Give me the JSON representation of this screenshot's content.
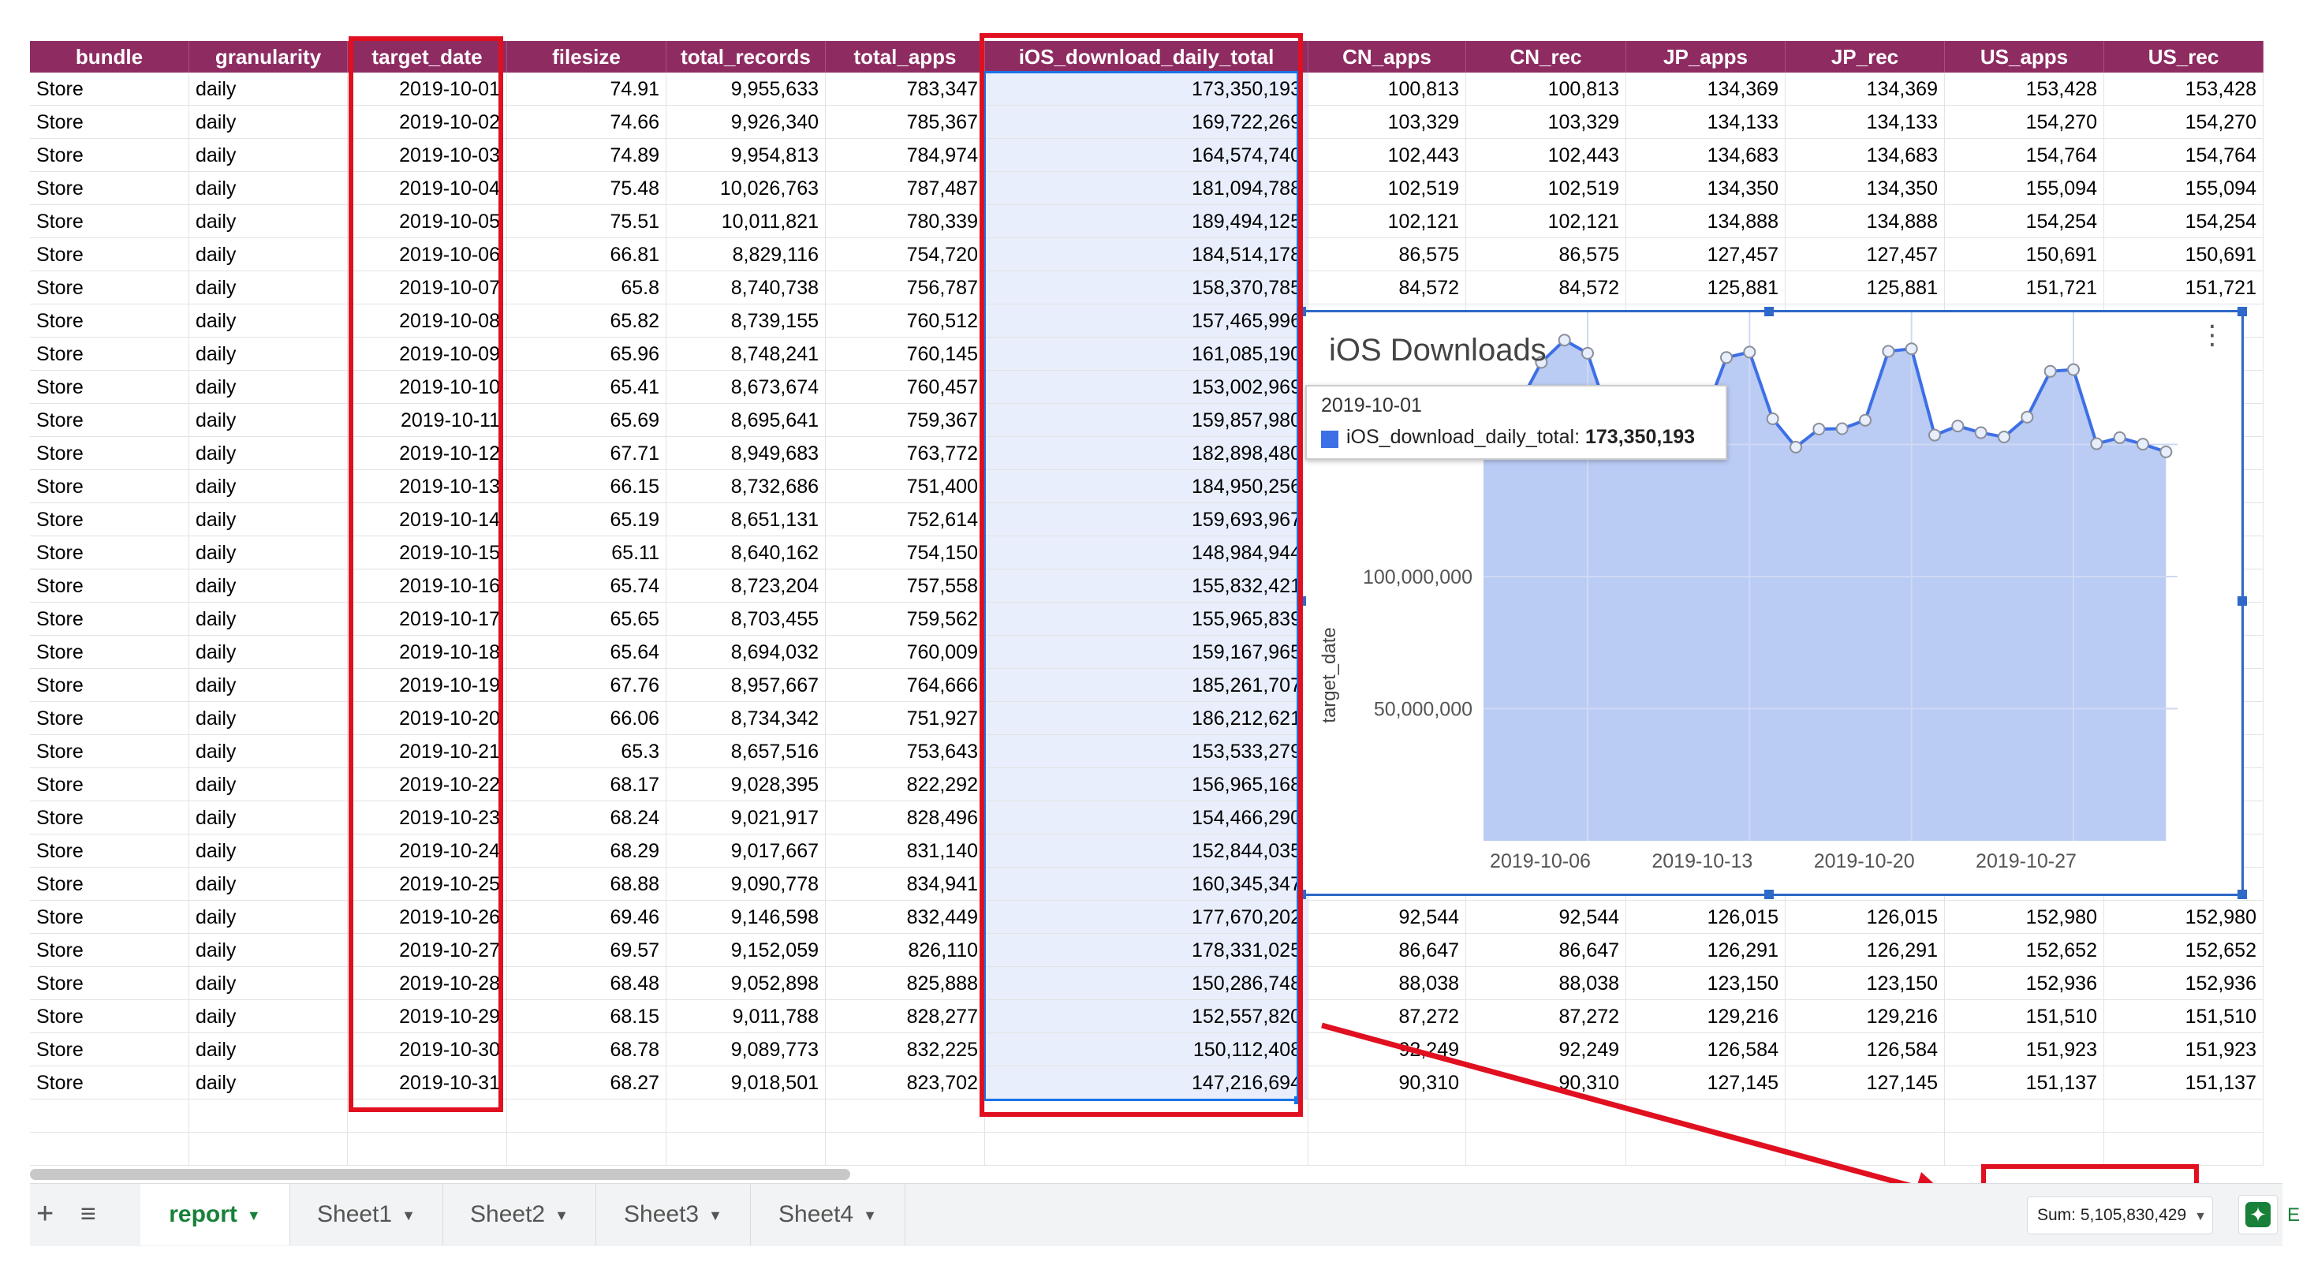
{
  "columns": [
    {
      "name": "bundle",
      "align": "left"
    },
    {
      "name": "granularity",
      "align": "left"
    },
    {
      "name": "target_date",
      "align": "right"
    },
    {
      "name": "filesize",
      "align": "right"
    },
    {
      "name": "total_records",
      "align": "right"
    },
    {
      "name": "total_apps",
      "align": "right"
    },
    {
      "name": "iOS_download_daily_total",
      "align": "right"
    },
    {
      "name": "CN_apps",
      "align": "right"
    },
    {
      "name": "CN_rec",
      "align": "right"
    },
    {
      "name": "JP_apps",
      "align": "right"
    },
    {
      "name": "JP_rec",
      "align": "right"
    },
    {
      "name": "US_apps",
      "align": "right"
    },
    {
      "name": "US_rec",
      "align": "right"
    }
  ],
  "rows": [
    [
      "Store",
      "daily",
      "2019-10-01",
      "74.91",
      "9,955,633",
      "783,347",
      "173,350,193",
      "100,813",
      "100,813",
      "134,369",
      "134,369",
      "153,428",
      "153,428"
    ],
    [
      "Store",
      "daily",
      "2019-10-02",
      "74.66",
      "9,926,340",
      "785,367",
      "169,722,269",
      "103,329",
      "103,329",
      "134,133",
      "134,133",
      "154,270",
      "154,270"
    ],
    [
      "Store",
      "daily",
      "2019-10-03",
      "74.89",
      "9,954,813",
      "784,974",
      "164,574,740",
      "102,443",
      "102,443",
      "134,683",
      "134,683",
      "154,764",
      "154,764"
    ],
    [
      "Store",
      "daily",
      "2019-10-04",
      "75.48",
      "10,026,763",
      "787,487",
      "181,094,788",
      "102,519",
      "102,519",
      "134,350",
      "134,350",
      "155,094",
      "155,094"
    ],
    [
      "Store",
      "daily",
      "2019-10-05",
      "75.51",
      "10,011,821",
      "780,339",
      "189,494,125",
      "102,121",
      "102,121",
      "134,888",
      "134,888",
      "154,254",
      "154,254"
    ],
    [
      "Store",
      "daily",
      "2019-10-06",
      "66.81",
      "8,829,116",
      "754,720",
      "184,514,178",
      "86,575",
      "86,575",
      "127,457",
      "127,457",
      "150,691",
      "150,691"
    ],
    [
      "Store",
      "daily",
      "2019-10-07",
      "65.8",
      "8,740,738",
      "756,787",
      "158,370,785",
      "84,572",
      "84,572",
      "125,881",
      "125,881",
      "151,721",
      "151,721"
    ],
    [
      "Store",
      "daily",
      "2019-10-08",
      "65.82",
      "8,739,155",
      "760,512",
      "157,465,996",
      "",
      "",
      "",
      "",
      "",
      ""
    ],
    [
      "Store",
      "daily",
      "2019-10-09",
      "65.96",
      "8,748,241",
      "760,145",
      "161,085,190",
      "",
      "",
      "",
      "",
      "",
      ""
    ],
    [
      "Store",
      "daily",
      "2019-10-10",
      "65.41",
      "8,673,674",
      "760,457",
      "153,002,969",
      "",
      "",
      "",
      "",
      "",
      ""
    ],
    [
      "Store",
      "daily",
      "2019-10-11",
      "65.69",
      "8,695,641",
      "759,367",
      "159,857,980",
      "",
      "",
      "",
      "",
      "",
      ""
    ],
    [
      "Store",
      "daily",
      "2019-10-12",
      "67.71",
      "8,949,683",
      "763,772",
      "182,898,480",
      "",
      "",
      "",
      "",
      "",
      ""
    ],
    [
      "Store",
      "daily",
      "2019-10-13",
      "66.15",
      "8,732,686",
      "751,400",
      "184,950,256",
      "",
      "",
      "",
      "",
      "",
      ""
    ],
    [
      "Store",
      "daily",
      "2019-10-14",
      "65.19",
      "8,651,131",
      "752,614",
      "159,693,967",
      "",
      "",
      "",
      "",
      "",
      ""
    ],
    [
      "Store",
      "daily",
      "2019-10-15",
      "65.11",
      "8,640,162",
      "754,150",
      "148,984,944",
      "",
      "",
      "",
      "",
      "",
      ""
    ],
    [
      "Store",
      "daily",
      "2019-10-16",
      "65.74",
      "8,723,204",
      "757,558",
      "155,832,421",
      "",
      "",
      "",
      "",
      "",
      ""
    ],
    [
      "Store",
      "daily",
      "2019-10-17",
      "65.65",
      "8,703,455",
      "759,562",
      "155,965,839",
      "",
      "",
      "",
      "",
      "",
      ""
    ],
    [
      "Store",
      "daily",
      "2019-10-18",
      "65.64",
      "8,694,032",
      "760,009",
      "159,167,965",
      "",
      "",
      "",
      "",
      "",
      ""
    ],
    [
      "Store",
      "daily",
      "2019-10-19",
      "67.76",
      "8,957,667",
      "764,666",
      "185,261,707",
      "",
      "",
      "",
      "",
      "",
      ""
    ],
    [
      "Store",
      "daily",
      "2019-10-20",
      "66.06",
      "8,734,342",
      "751,927",
      "186,212,621",
      "",
      "",
      "",
      "",
      "",
      ""
    ],
    [
      "Store",
      "daily",
      "2019-10-21",
      "65.3",
      "8,657,516",
      "753,643",
      "153,533,279",
      "",
      "",
      "",
      "",
      "",
      ""
    ],
    [
      "Store",
      "daily",
      "2019-10-22",
      "68.17",
      "9,028,395",
      "822,292",
      "156,965,168",
      "",
      "",
      "",
      "",
      "",
      ""
    ],
    [
      "Store",
      "daily",
      "2019-10-23",
      "68.24",
      "9,021,917",
      "828,496",
      "154,466,290",
      "",
      "",
      "",
      "",
      "",
      ""
    ],
    [
      "Store",
      "daily",
      "2019-10-24",
      "68.29",
      "9,017,667",
      "831,140",
      "152,844,035",
      "",
      "",
      "",
      "",
      "",
      ""
    ],
    [
      "Store",
      "daily",
      "2019-10-25",
      "68.88",
      "9,090,778",
      "834,941",
      "160,345,347",
      "",
      "",
      "",
      "",
      "",
      ""
    ],
    [
      "Store",
      "daily",
      "2019-10-26",
      "69.46",
      "9,146,598",
      "832,449",
      "177,670,202",
      "92,544",
      "92,544",
      "126,015",
      "126,015",
      "152,980",
      "152,980"
    ],
    [
      "Store",
      "daily",
      "2019-10-27",
      "69.57",
      "9,152,059",
      "826,110",
      "178,331,025",
      "86,647",
      "86,647",
      "126,291",
      "126,291",
      "152,652",
      "152,652"
    ],
    [
      "Store",
      "daily",
      "2019-10-28",
      "68.48",
      "9,052,898",
      "825,888",
      "150,286,748",
      "88,038",
      "88,038",
      "123,150",
      "123,150",
      "152,936",
      "152,936"
    ],
    [
      "Store",
      "daily",
      "2019-10-29",
      "68.15",
      "9,011,788",
      "828,277",
      "152,557,820",
      "87,272",
      "87,272",
      "129,216",
      "129,216",
      "151,510",
      "151,510"
    ],
    [
      "Store",
      "daily",
      "2019-10-30",
      "68.78",
      "9,089,773",
      "832,225",
      "150,112,408",
      "92,249",
      "92,249",
      "126,584",
      "126,584",
      "151,923",
      "151,923"
    ],
    [
      "Store",
      "daily",
      "2019-10-31",
      "68.27",
      "9,018,501",
      "823,702",
      "147,216,694",
      "90,310",
      "90,310",
      "127,145",
      "127,145",
      "151,137",
      "151,137"
    ]
  ],
  "chart_data": {
    "type": "area",
    "title": "iOS Downloads",
    "xlabel": "",
    "ylabel": "target_date",
    "series": [
      {
        "name": "iOS_download_daily_total",
        "values": [
          173350193,
          169722269,
          164574740,
          181094788,
          189494125,
          184514178,
          158370785,
          157465996,
          161085190,
          153002969,
          159857980,
          182898480,
          184950256,
          159693967,
          148984944,
          155832421,
          155965839,
          159167965,
          185261707,
          186212621,
          153533279,
          156965168,
          154466290,
          152844035,
          160345347,
          177670202,
          178331025,
          150286748,
          152557820,
          150112408,
          147216694
        ]
      }
    ],
    "x_start": "2019-10-01",
    "x_tick_labels": [
      "2019-10-06",
      "2019-10-13",
      "2019-10-20",
      "2019-10-27"
    ],
    "y_tick_labels": [
      "50,000,000",
      "100,000,000",
      "150,000,000"
    ],
    "y_ticks": [
      50000000,
      100000000,
      150000000
    ],
    "ylim": [
      0,
      200000000
    ],
    "grid": true,
    "color": "#3d6fe6",
    "fill_color": "#bacbf4",
    "tooltip": {
      "date": "2019-10-01",
      "series": "iOS_download_daily_total:",
      "value": "173,350,193"
    }
  },
  "chart_menu_icon": "more-vert-icon",
  "sheets": {
    "tabs": [
      {
        "label": "report",
        "active": true
      },
      {
        "label": "Sheet1",
        "active": false
      },
      {
        "label": "Sheet2",
        "active": false
      },
      {
        "label": "Sheet3",
        "active": false
      },
      {
        "label": "Sheet4",
        "active": false
      }
    ],
    "add_icon": "plus-icon",
    "list_icon": "list-icon",
    "sum_label": "Sum: 5,105,830,429",
    "explore_label": "E"
  },
  "colors": {
    "header_bg": "#8e2c62",
    "selection": "#1a73e8",
    "annotation": "#e01020",
    "active_tab": "#188038"
  }
}
